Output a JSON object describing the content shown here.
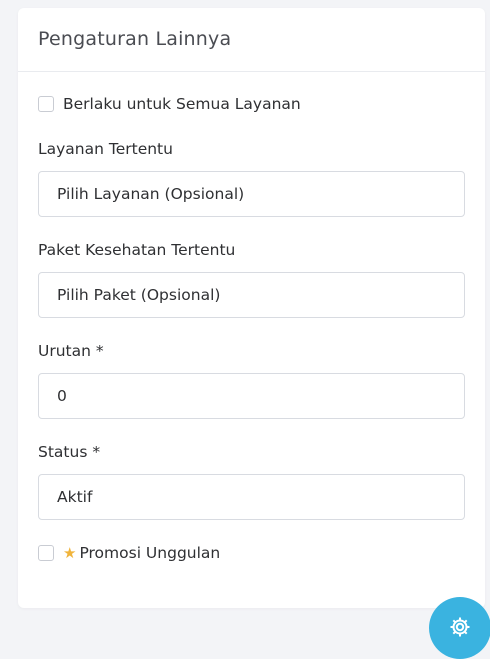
{
  "card": {
    "title": "Pengaturan Lainnya"
  },
  "apply_all": {
    "label": "Berlaku untuk Semua Layanan",
    "checked": false
  },
  "service": {
    "label": "Layanan Tertentu",
    "value": "Pilih Layanan (Opsional)"
  },
  "package": {
    "label": "Paket Kesehatan Tertentu",
    "value": "Pilih Paket (Opsional)"
  },
  "order": {
    "label": "Urutan *",
    "value": "0"
  },
  "status": {
    "label": "Status *",
    "value": "Aktif"
  },
  "featured": {
    "label": "Promosi Unggulan",
    "checked": false,
    "icon": "star-icon"
  },
  "fab": {
    "icon": "gear-icon",
    "color": "#3ab3e0"
  }
}
